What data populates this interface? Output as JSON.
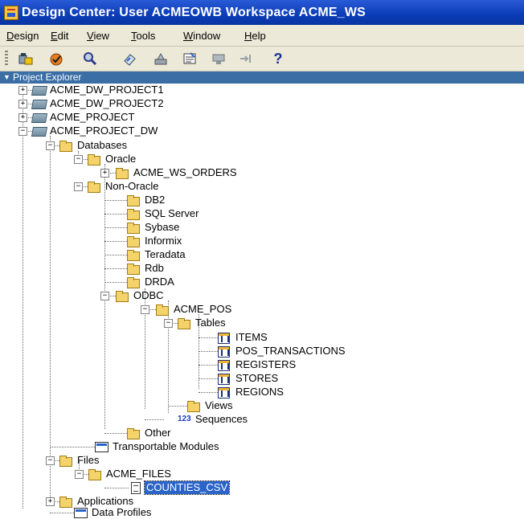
{
  "window": {
    "title": "Design Center: User ACMEOWB   Workspace ACME_WS"
  },
  "menu": [
    {
      "label": "Design",
      "key": "D",
      "rest": "esign"
    },
    {
      "label": "Edit",
      "key": "E",
      "rest": "dit"
    },
    {
      "label": "View",
      "key": "V",
      "rest": "iew"
    },
    {
      "label": "Tools",
      "key": "T",
      "rest": "ools"
    },
    {
      "label": "Window",
      "key": "W",
      "rest": "indow"
    },
    {
      "label": "Help",
      "key": "H",
      "rest": "elp"
    }
  ],
  "toolbar": {
    "icons": [
      "deploy-icon",
      "validate-icon",
      "search-icon",
      "edit-icon",
      "properties-icon",
      "configure-icon",
      "navigate-icon",
      "merge-icon",
      "help-icon"
    ],
    "help_label": "?"
  },
  "explorer": {
    "title": "Project Explorer",
    "nodes": [
      "ACME_DW_PROJECT1",
      "ACME_DW_PROJECT2",
      "ACME_PROJECT",
      "ACME_PROJECT_DW",
      "Databases",
      "Oracle",
      "ACME_WS_ORDERS",
      "Non-Oracle",
      "DB2",
      "SQL Server",
      "Sybase",
      "Informix",
      "Teradata",
      "Rdb",
      "DRDA",
      "ODBC",
      "ACME_POS",
      "Tables",
      "ITEMS",
      "POS_TRANSACTIONS",
      "REGISTERS",
      "STORES",
      "REGIONS",
      "Views",
      "Sequences",
      "Other",
      "Transportable Modules",
      "Files",
      "ACME_FILES",
      "COUNTIES_CSV",
      "Applications",
      "Data Profiles"
    ],
    "selected": "COUNTIES_CSV",
    "sequence_glyph": "123",
    "collapsed_sign": "+",
    "expanded_sign": "−"
  },
  "colors": {
    "title_bar": "#0b3cb8",
    "selection": "#2b64c8",
    "folder": "#f3d36a",
    "chrome": "#ece9d8"
  }
}
